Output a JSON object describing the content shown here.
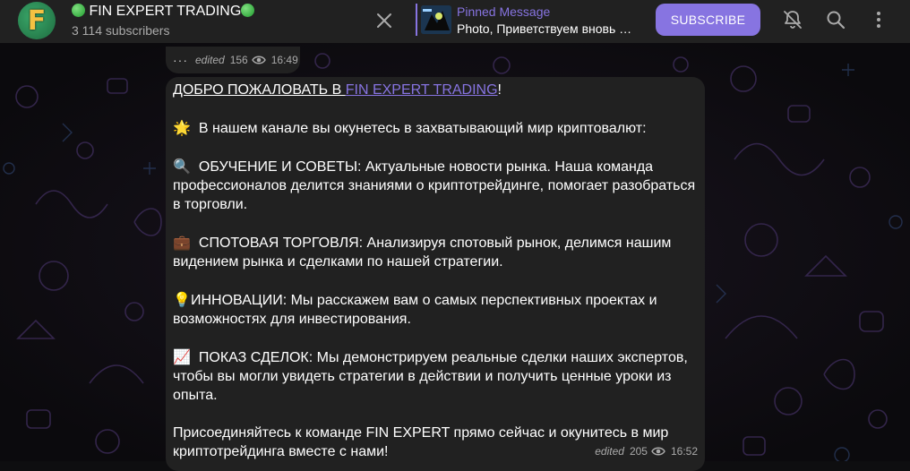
{
  "header": {
    "avatar_letter": "F",
    "title": "FIN EXPERT TRADING",
    "subscribers": "3 114 subscribers",
    "pinned_label": "Pinned Message",
    "pinned_text": "Photo, Приветствуем вновь …",
    "subscribe_label": "SUBSCRIBE",
    "icons": [
      "close-icon",
      "bell-off-icon",
      "search-icon",
      "more-vert-icon"
    ]
  },
  "prev_message": {
    "more": "···",
    "edited": "edited",
    "views": "156",
    "time": "16:49"
  },
  "message": {
    "line1_prefix": "ДОБРО ПОЖАЛОВАТЬ В ",
    "line1_link": "FIN EXPERT TRADING",
    "line1_suffix": "!",
    "intro_emoji": "🌟",
    "intro": "В нашем канале вы окунетесь в захватывающий мир криптовалют:",
    "edu_emoji": "🔍",
    "edu": "ОБУЧЕНИЕ И СОВЕТЫ: Актуальные новости рынка. Наша команда профессионалов делится знаниями о криптотрейдинге, помогает разобраться в торговли.",
    "spot_emoji": "💼",
    "spot": "СПОТОВАЯ ТОРГОВЛЯ: Анализируя спотовый рынок, делимся нашим видением рынка и сделками по нашей стратегии.",
    "innov_emoji": "💡",
    "innov": "ИННОВАЦИИ: Мы расскажем вам о самых перспективных проектах и возможностях для инвестирования.",
    "deals_emoji": "📈",
    "deals": "ПОКАЗ СДЕЛОК: Мы демонстрируем реальные сделки наших экспертов, чтобы вы могли увидеть стратегии в действии и получить ценные уроки из опыта.",
    "outro": "Присоединяйтесь к команде FIN EXPERT прямо сейчас и окунитесь в мир криптотрейдинга вместе с нами!",
    "edited": "edited",
    "views": "205",
    "time": "16:52"
  },
  "colors": {
    "accent": "#8774e1",
    "header_bg": "#212121",
    "bubble_bg": "#212121",
    "secondary_text": "#aaaaaa"
  }
}
